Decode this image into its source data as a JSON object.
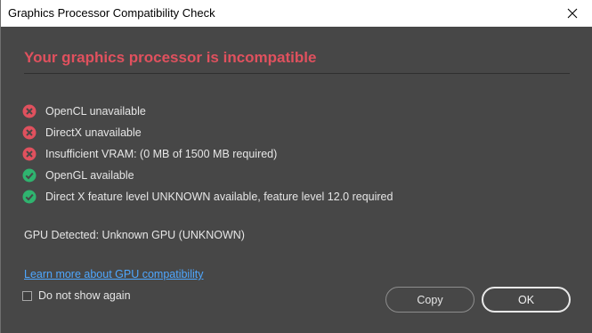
{
  "window": {
    "title": "Graphics Processor Compatibility Check",
    "close_icon": "close-icon"
  },
  "heading": "Your graphics processor is incompatible",
  "heading_color": "#e0515e",
  "checks": [
    {
      "status": "fail",
      "icon": "error-icon",
      "label": "OpenCL unavailable"
    },
    {
      "status": "fail",
      "icon": "error-icon",
      "label": "DirectX unavailable"
    },
    {
      "status": "fail",
      "icon": "error-icon",
      "label": "Insufficient VRAM: (0 MB of 1500 MB required)"
    },
    {
      "status": "pass",
      "icon": "check-icon",
      "label": "OpenGL available"
    },
    {
      "status": "pass",
      "icon": "check-icon",
      "label": "Direct X feature level UNKNOWN available, feature level 12.0 required"
    }
  ],
  "status_colors": {
    "fail": "#e0515e",
    "pass": "#2fb46f"
  },
  "gpu_detected": "GPU Detected: Unknown GPU (UNKNOWN)",
  "learn_more_link": "Learn more about GPU compatibility",
  "dont_show_again": {
    "label": "Do not show again",
    "checked": false
  },
  "buttons": {
    "copy": "Copy",
    "ok": "OK"
  }
}
